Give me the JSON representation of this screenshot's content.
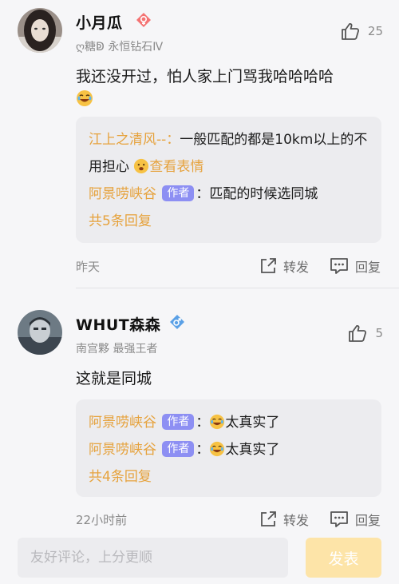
{
  "comments": [
    {
      "user": "小月瓜",
      "sub": "ღ糖ↁ 永恒钻石Ⅳ",
      "likes": "25",
      "text": "我还没开过，怕人家上门骂我哈哈哈哈",
      "replies": [
        {
          "name": "江上之清风--：",
          "text": "一般匹配的都是10km以上的不用担心",
          "link": "查看表情"
        },
        {
          "name": "阿景唠峡谷",
          "tag": "作者",
          "sep": "：",
          "text": "匹配的时候选同城"
        }
      ],
      "more": "共5条回复",
      "time": "昨天",
      "forward": "转发",
      "reply": "回复"
    },
    {
      "user": "WHUT森森",
      "sub": "南宫夥 最强王者",
      "likes": "5",
      "text": "这就是同城",
      "replies": [
        {
          "name": "阿景唠峡谷",
          "tag": "作者",
          "sep": "：",
          "text": "太真实了"
        },
        {
          "name": "阿景唠峡谷",
          "tag": "作者",
          "sep": "：",
          "text": "太真实了"
        }
      ],
      "more": "共4条回复",
      "time": "22小时前",
      "forward": "转发",
      "reply": "回复"
    }
  ],
  "bottom": {
    "placeholder": "友好评论，上分更顺",
    "send": "发表"
  },
  "colors": {
    "accent": "#e6a23c",
    "author_tag": "#8d8ff3",
    "female": "#f47373",
    "male": "#5aa0e6"
  }
}
